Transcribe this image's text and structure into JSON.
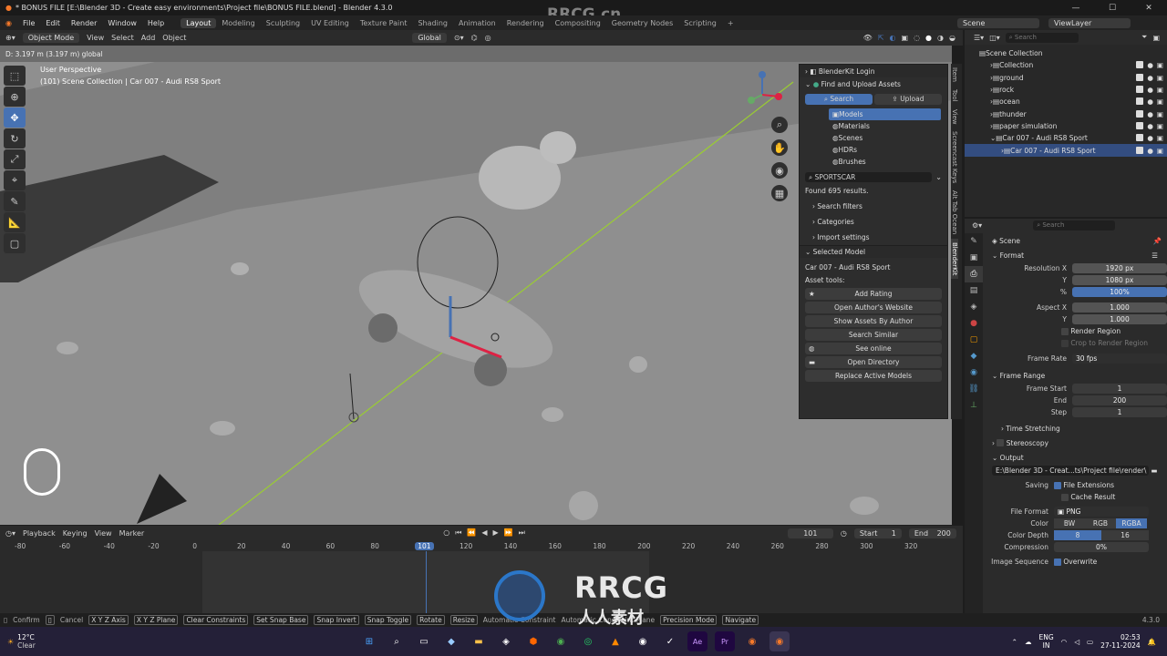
{
  "window": {
    "title": "* BONUS FILE [E:\\Blender 3D - Create easy environments\\Project file\\BONUS FILE.blend] - Blender 4.3.0",
    "watermark_top": "RRCG.cn"
  },
  "menu": {
    "items": [
      "File",
      "Edit",
      "Render",
      "Window",
      "Help"
    ],
    "workspaces": [
      "Layout",
      "Modeling",
      "Sculpting",
      "UV Editing",
      "Texture Paint",
      "Shading",
      "Animation",
      "Rendering",
      "Compositing",
      "Geometry Nodes",
      "Scripting"
    ],
    "add_tab": "+",
    "scene": "Scene",
    "view_layer": "ViewLayer"
  },
  "viewport_header": {
    "mode": "Object Mode",
    "menus": [
      "View",
      "Select",
      "Add",
      "Object"
    ],
    "transform": "Global",
    "status": "D: 3.197 m (3.197 m) global"
  },
  "viewport": {
    "title": "User Perspective",
    "subtitle": "(101) Scene Collection | Car 007 - Audi RS8 Sport"
  },
  "npanel": {
    "login": "BlenderKit Login",
    "find_upload": "Find and Upload Assets",
    "search_tab": "Search",
    "upload_tab": "Upload",
    "categories": [
      "Models",
      "Materials",
      "Scenes",
      "HDRs",
      "Brushes"
    ],
    "search_value": "SPORTSCAR",
    "found": "Found 695 results.",
    "sections": [
      "Search filters",
      "Categories",
      "Import settings"
    ],
    "selected_model_header": "Selected Model",
    "selected_model": "Car 007 - Audi RS8 Sport",
    "asset_tools": "Asset tools:",
    "buttons": [
      "Add Rating",
      "Open Author's Website",
      "Show Assets By Author",
      "Search Similar",
      "See online",
      "Open Directory",
      "Replace Active Models"
    ]
  },
  "sidetabs": [
    "Item",
    "Tool",
    "View",
    "Screencast Keys",
    "Alt Tab Ocean",
    "BlenderKit"
  ],
  "outliner": {
    "search_placeholder": "Search",
    "root": "Scene Collection",
    "rows": [
      {
        "label": "Collection",
        "indent": 1
      },
      {
        "label": "ground",
        "indent": 1
      },
      {
        "label": "rock",
        "indent": 1
      },
      {
        "label": "ocean",
        "indent": 1
      },
      {
        "label": "thunder",
        "indent": 1
      },
      {
        "label": "paper simulation",
        "indent": 1
      },
      {
        "label": "Car 007 - Audi RS8 Sport",
        "indent": 1
      },
      {
        "label": "Car 007 - Audi RS8 Sport",
        "indent": 2,
        "selected": true
      }
    ]
  },
  "properties": {
    "search_placeholder": "Search",
    "scene": "Scene",
    "format_header": "Format",
    "resolution_x_label": "Resolution X",
    "resolution_x": "1920 px",
    "resolution_y_label": "Y",
    "resolution_y": "1080 px",
    "percent_label": "%",
    "percent": "100%",
    "aspect_x_label": "Aspect X",
    "aspect_x": "1.000",
    "aspect_y_label": "Y",
    "aspect_y": "1.000",
    "render_region": "Render Region",
    "crop_region": "Crop to Render Region",
    "frame_rate_label": "Frame Rate",
    "frame_rate": "30 fps",
    "frame_range_header": "Frame Range",
    "frame_start_label": "Frame Start",
    "frame_start": "1",
    "end_label": "End",
    "end": "200",
    "step_label": "Step",
    "step": "1",
    "time_stretching": "Time Stretching",
    "stereoscopy": "Stereoscopy",
    "output_header": "Output",
    "output_path": "E:\\Blender 3D - Creat...ts\\Project file\\render\\",
    "saving_label": "Saving",
    "file_extensions": "File Extensions",
    "cache_result": "Cache Result",
    "file_format_label": "File Format",
    "file_format": "PNG",
    "color_label": "Color",
    "color_opts": [
      "BW",
      "RGB",
      "RGBA"
    ],
    "color_depth_label": "Color Depth",
    "depth_opts": [
      "8",
      "16"
    ],
    "compression_label": "Compression",
    "compression": "0%",
    "image_sequence_label": "Image Sequence",
    "overwrite": "Overwrite",
    "version": "4.3.0"
  },
  "timeline": {
    "menus": [
      "Playback",
      "Keying",
      "View",
      "Marker"
    ],
    "current": "101",
    "start_label": "Start",
    "start": "1",
    "end_label": "End",
    "end": "200",
    "ticks": [
      "-80",
      "-60",
      "-40",
      "-20",
      "0",
      "20",
      "40",
      "60",
      "80",
      "101",
      "120",
      "140",
      "160",
      "180",
      "200",
      "220",
      "240",
      "260",
      "280",
      "300",
      "320"
    ]
  },
  "statusbar": {
    "items": [
      "Confirm",
      "Cancel",
      "X Y Z Axis",
      "X Y Z Plane",
      "Clear Constraints",
      "Set Snap Base",
      "Snap Invert",
      "Snap Toggle",
      "Rotate",
      "Resize",
      "Automatic Constraint",
      "Automatic Constraint Plane",
      "Precision Mode",
      "Navigate"
    ]
  },
  "taskbar": {
    "temp": "12°C",
    "weather": "Clear",
    "lang": "ENG",
    "region": "IN",
    "time": "02:53",
    "date": "27-11-2024"
  },
  "watermark": {
    "brand": "RRCG",
    "sub": "人人素材"
  },
  "colors": {
    "accent": "#4772b3",
    "viewport": "#8d8d8d",
    "green_axis": "#9acd32"
  }
}
